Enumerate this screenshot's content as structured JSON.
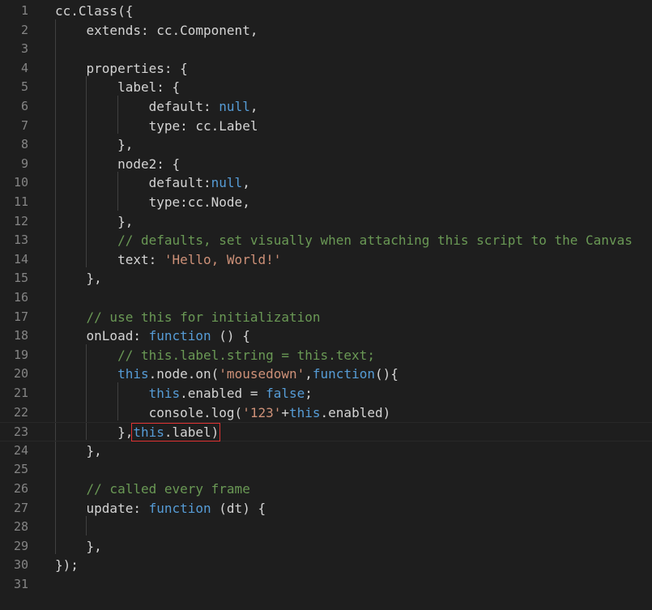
{
  "editor": {
    "line_numbers": [
      "1",
      "2",
      "3",
      "4",
      "5",
      "6",
      "7",
      "8",
      "9",
      "10",
      "11",
      "12",
      "13",
      "14",
      "15",
      "16",
      "17",
      "18",
      "19",
      "20",
      "21",
      "22",
      "23",
      "24",
      "25",
      "26",
      "27",
      "28",
      "29",
      "30",
      "31"
    ],
    "lines": [
      [
        {
          "t": "cc.Class({",
          "c": "plain"
        }
      ],
      [
        {
          "t": "    extends: cc.Component,",
          "c": "plain"
        }
      ],
      [],
      [
        {
          "t": "    properties: {",
          "c": "plain"
        }
      ],
      [
        {
          "t": "        label: {",
          "c": "plain"
        }
      ],
      [
        {
          "t": "            default: ",
          "c": "plain"
        },
        {
          "t": "null",
          "c": "kw"
        },
        {
          "t": ",",
          "c": "plain"
        }
      ],
      [
        {
          "t": "            type: cc.Label",
          "c": "plain"
        }
      ],
      [
        {
          "t": "        },",
          "c": "plain"
        }
      ],
      [
        {
          "t": "        node2: {",
          "c": "plain"
        }
      ],
      [
        {
          "t": "            default:",
          "c": "plain"
        },
        {
          "t": "null",
          "c": "kw"
        },
        {
          "t": ",",
          "c": "plain"
        }
      ],
      [
        {
          "t": "            type:cc.Node,",
          "c": "plain"
        }
      ],
      [
        {
          "t": "        },",
          "c": "plain"
        }
      ],
      [
        {
          "t": "        // defaults, set visually when attaching this script to the Canvas",
          "c": "com"
        }
      ],
      [
        {
          "t": "        text: ",
          "c": "plain"
        },
        {
          "t": "'Hello, World!'",
          "c": "str"
        }
      ],
      [
        {
          "t": "    },",
          "c": "plain"
        }
      ],
      [],
      [
        {
          "t": "    // use this for initialization",
          "c": "com"
        }
      ],
      [
        {
          "t": "    onLoad: ",
          "c": "plain"
        },
        {
          "t": "function",
          "c": "kw"
        },
        {
          "t": " () {",
          "c": "plain"
        }
      ],
      [
        {
          "t": "        // this.label.string = this.text;",
          "c": "com"
        }
      ],
      [
        {
          "t": "        ",
          "c": "plain"
        },
        {
          "t": "this",
          "c": "kw"
        },
        {
          "t": ".node.on(",
          "c": "plain"
        },
        {
          "t": "'mousedown'",
          "c": "str"
        },
        {
          "t": ",",
          "c": "plain"
        },
        {
          "t": "function",
          "c": "kw"
        },
        {
          "t": "(){",
          "c": "plain"
        }
      ],
      [
        {
          "t": "            ",
          "c": "plain"
        },
        {
          "t": "this",
          "c": "kw"
        },
        {
          "t": ".enabled = ",
          "c": "plain"
        },
        {
          "t": "false",
          "c": "kw"
        },
        {
          "t": ";",
          "c": "plain"
        }
      ],
      [
        {
          "t": "            console.log(",
          "c": "plain"
        },
        {
          "t": "'123'",
          "c": "str"
        },
        {
          "t": "+",
          "c": "plain"
        },
        {
          "t": "this",
          "c": "kw"
        },
        {
          "t": ".enabled)",
          "c": "plain"
        }
      ],
      [
        {
          "t": "        },",
          "c": "plain"
        },
        {
          "t": "this",
          "c": "kw",
          "box": true
        },
        {
          "t": ".label)",
          "c": "plain",
          "box": true
        }
      ],
      [
        {
          "t": "    },",
          "c": "plain"
        }
      ],
      [],
      [
        {
          "t": "    // called every frame",
          "c": "com"
        }
      ],
      [
        {
          "t": "    update: ",
          "c": "plain"
        },
        {
          "t": "function",
          "c": "kw"
        },
        {
          "t": " (dt) {",
          "c": "plain"
        }
      ],
      [],
      [
        {
          "t": "    },",
          "c": "plain"
        }
      ],
      [
        {
          "t": "});",
          "c": "plain"
        }
      ],
      []
    ],
    "current_line": 23,
    "colors": {
      "background": "#1e1e1e",
      "keyword": "#569cd6",
      "string": "#ce9178",
      "comment": "#6a9955",
      "line_number": "#858585",
      "selection_box": "#e03232"
    }
  }
}
